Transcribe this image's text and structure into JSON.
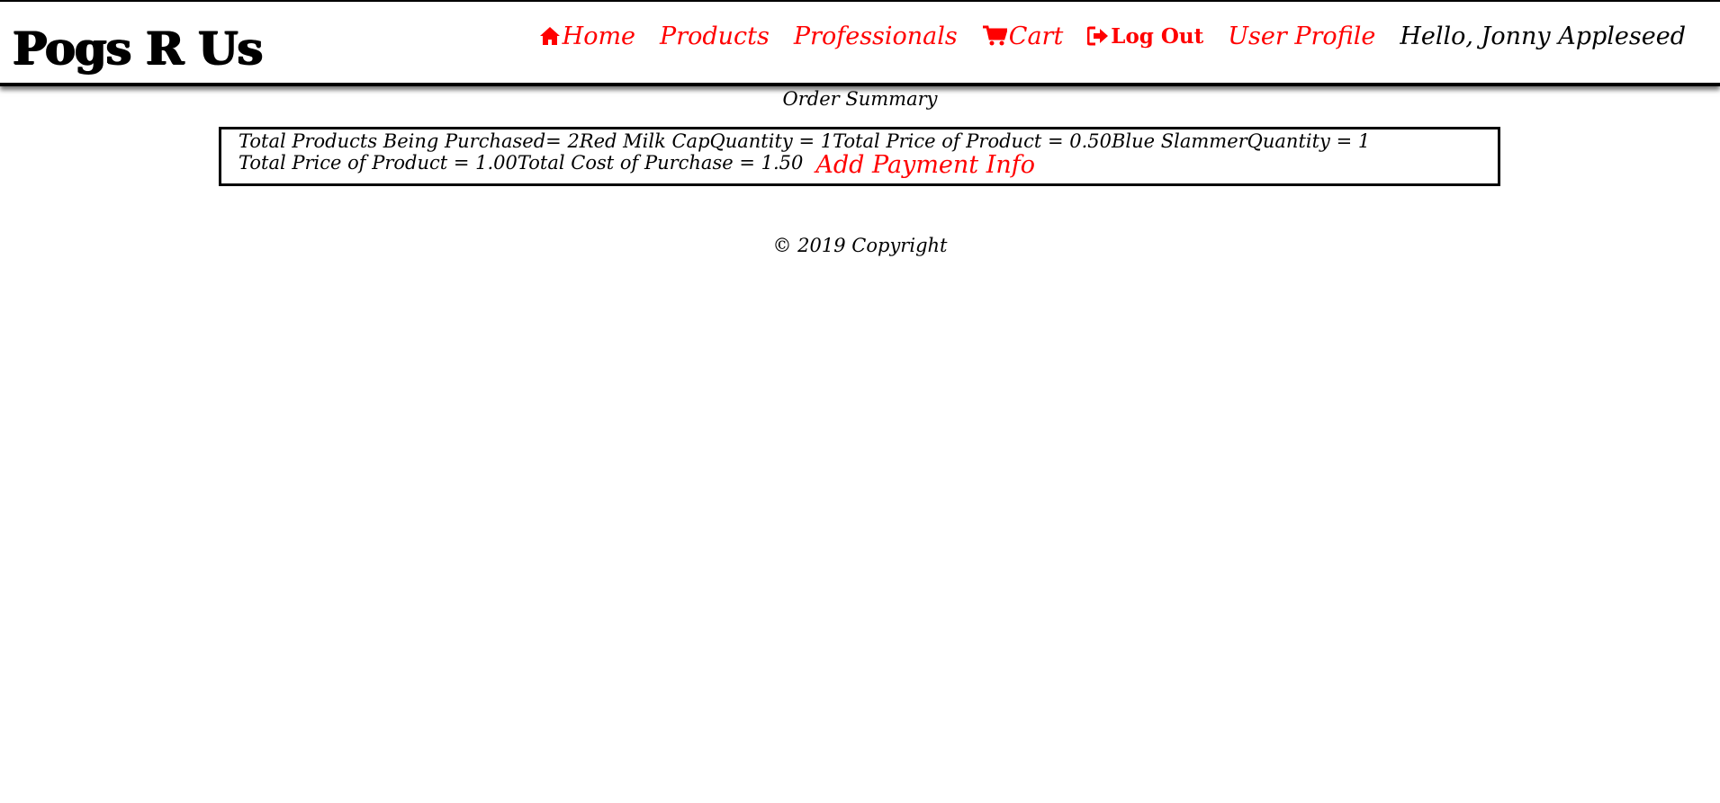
{
  "header": {
    "brand": "Pogs R Us",
    "nav": {
      "home": "Home",
      "products": "Products",
      "professionals": "Professionals",
      "cart": "Cart",
      "logout": "Log Out",
      "profile": "User Profile"
    },
    "greeting": "Hello, Jonny Appleseed"
  },
  "main": {
    "title": "Order Summary",
    "line1": "Total Products Being Purchased= 2Red Milk CapQuantity = 1Total Price of Product = 0.50Blue SlammerQuantity = 1",
    "line2": "Total Price of Product = 1.00Total Cost of Purchase = 1.50",
    "payment_link": "Add Payment Info"
  },
  "footer": {
    "copyright": "© 2019 Copyright"
  },
  "colors": {
    "link": "#ff0000",
    "text": "#000000",
    "background": "#ffffff"
  },
  "icons": {
    "home": "home-icon",
    "cart": "cart-icon",
    "logout": "logout-icon"
  }
}
